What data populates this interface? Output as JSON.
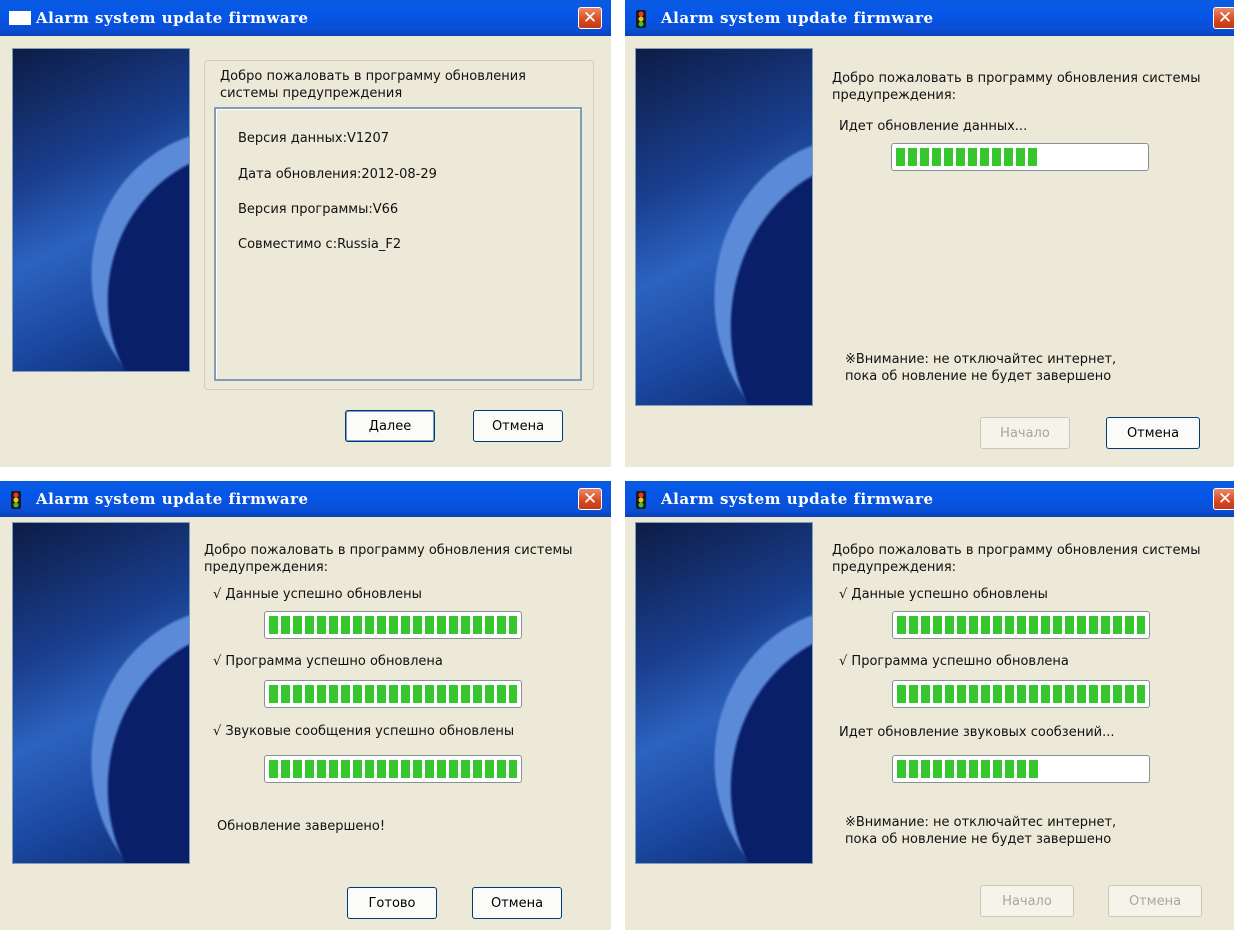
{
  "title": "Alarm system update firmware",
  "close_glyph": "✕",
  "colors": {
    "titlebar": "#0556e8",
    "progress_fill": "#37c62e",
    "close_button": "#d6491f"
  },
  "windows": [
    {
      "welcome": "Добро пожаловать в программу обновления системы предупреждения",
      "info": [
        "Версия данных:V1207",
        "Дата обновления:2012-08-29",
        "Версия программы:V66",
        "Совместимо c:Russia_F2"
      ],
      "next_label": "Далее",
      "cancel_label": "Отмена"
    },
    {
      "welcome": "Добро пожаловать в программу обновления системы предупреждения:",
      "status": "Идет обновление данных...",
      "progress": 0.58,
      "warning": "※Внимание: не отключайтес интернет, пока об новление не будет завершено",
      "start_label": "Начало",
      "cancel_label": "Отмена"
    },
    {
      "welcome": "Добро пожаловать в программу обновления системы предупреждения:",
      "step1": "√ Данные успешно обновлены",
      "step2": "√ Программа успешно обновлена",
      "step3": "√ Звуковые сообщения успешно обновлены",
      "progress1": 1.0,
      "progress2": 1.0,
      "progress3": 1.0,
      "done": "Обновление завершено!",
      "finish_label": "Готово",
      "cancel_label": "Отмена"
    },
    {
      "welcome": "Добро пожаловать в программу обновления системы предупреждения:",
      "step1": "√ Данные успешно обновлены",
      "step2": "√ Программа успешно обновлена",
      "status": "Идет обновление звуковых сообзений...",
      "progress1": 1.0,
      "progress2": 1.0,
      "progress3": 0.58,
      "warning": "※Внимание: не отключайтес интернет, пока об новление не будет завершено",
      "start_label": "Начало",
      "cancel_label": "Отмена"
    }
  ]
}
